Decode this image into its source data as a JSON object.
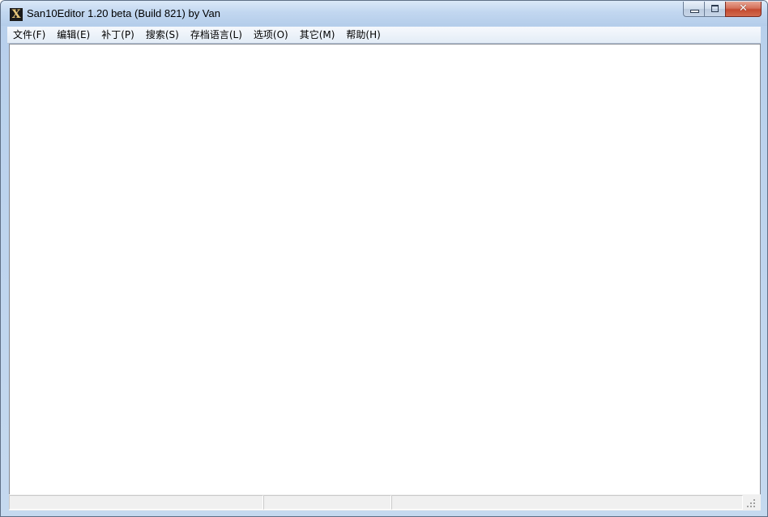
{
  "window": {
    "title": "San10Editor 1.20 beta (Build 821) by Van",
    "icon": "app-x-icon",
    "icon_glyph": "X",
    "caption_buttons": {
      "minimize_icon": "minimize-icon",
      "maximize_icon": "maximize-icon",
      "close_icon": "close-icon",
      "close_glyph": "✕"
    }
  },
  "menubar": {
    "items": [
      {
        "label": "文件(F)"
      },
      {
        "label": "编辑(E)"
      },
      {
        "label": "补丁(P)"
      },
      {
        "label": "搜索(S)"
      },
      {
        "label": "存档语言(L)"
      },
      {
        "label": "选项(O)"
      },
      {
        "label": "其它(M)"
      },
      {
        "label": "帮助(H)"
      }
    ]
  },
  "statusbar": {
    "panes": [
      "",
      "",
      ""
    ]
  },
  "colors": {
    "title_gradient_top": "#dbe9f8",
    "title_gradient_bottom": "#b4cdea",
    "close_button": "#c44a30",
    "client_background": "#ffffff"
  }
}
